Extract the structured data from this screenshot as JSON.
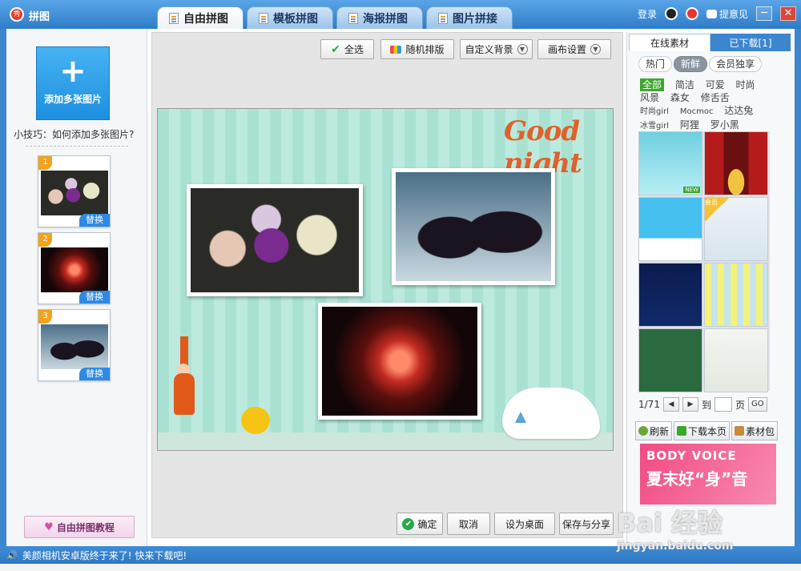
{
  "app": {
    "title": "拼图",
    "logo_text": "秀"
  },
  "tabs": [
    {
      "label": "自由拼图",
      "active": true
    },
    {
      "label": "模板拼图",
      "active": false
    },
    {
      "label": "海报拼图",
      "active": false
    },
    {
      "label": "图片拼接",
      "active": false
    }
  ],
  "topbar": {
    "login": "登录",
    "feedback": "提意见",
    "minimize": "─",
    "close": "✕"
  },
  "left": {
    "add_plus": "+",
    "add_label": "添加多张图片",
    "tip": "小技巧：如何添加多张图片?",
    "thumbs": [
      {
        "num": "1",
        "replace": "替换"
      },
      {
        "num": "2",
        "replace": "替换"
      },
      {
        "num": "3",
        "replace": "替换"
      }
    ],
    "tutorial": "自由拼图教程"
  },
  "toolbar": {
    "select_all": "全选",
    "random": "随机排版",
    "custom_bg": "自定义背景",
    "canvas_settings": "画布设置"
  },
  "canvas": {
    "title_art": "Good night"
  },
  "bottom": {
    "ok": "确定",
    "cancel": "取消",
    "set_desktop": "设为桌面",
    "save_share": "保存与分享"
  },
  "right": {
    "tab_online": "在线素材",
    "tab_downloaded": "已下载[1]",
    "chips": [
      {
        "label": "热门",
        "active": false
      },
      {
        "label": "新鲜",
        "active": true
      },
      {
        "label": "会员独享",
        "active": false
      }
    ],
    "categories_row1": [
      "全部",
      "简洁",
      "可爱",
      "时尚"
    ],
    "categories_row2": [
      "风景",
      "森女",
      "修舌舌"
    ],
    "categories_row3": [
      "时尚girl",
      "Mocmoc",
      "达达兔"
    ],
    "categories_row4": [
      "冰雪girl",
      "阿狸",
      "罗小黑"
    ],
    "tile_new": "NEW",
    "tile_member": "会员",
    "pager": {
      "page": "1/71",
      "prev": "◀",
      "next": "▶",
      "goto": "到",
      "unit": "页",
      "go": "GO"
    },
    "actions": {
      "refresh": "刷新",
      "download_page": "下载本页",
      "package": "素材包"
    },
    "ad": {
      "line1": "BODY VOICE",
      "line2": "夏末好“身”音"
    }
  },
  "status": {
    "message": "美颜相机安卓版终于来了! 快来下载吧!"
  },
  "watermark": {
    "line1": "Bai 经验",
    "line2": "jingyan.baidu.com"
  },
  "colors": {
    "accent": "#3b86cf",
    "add_button": "#2a9be8",
    "canvas_bg": "#b3e6d9",
    "title_art": "#e0612a"
  }
}
